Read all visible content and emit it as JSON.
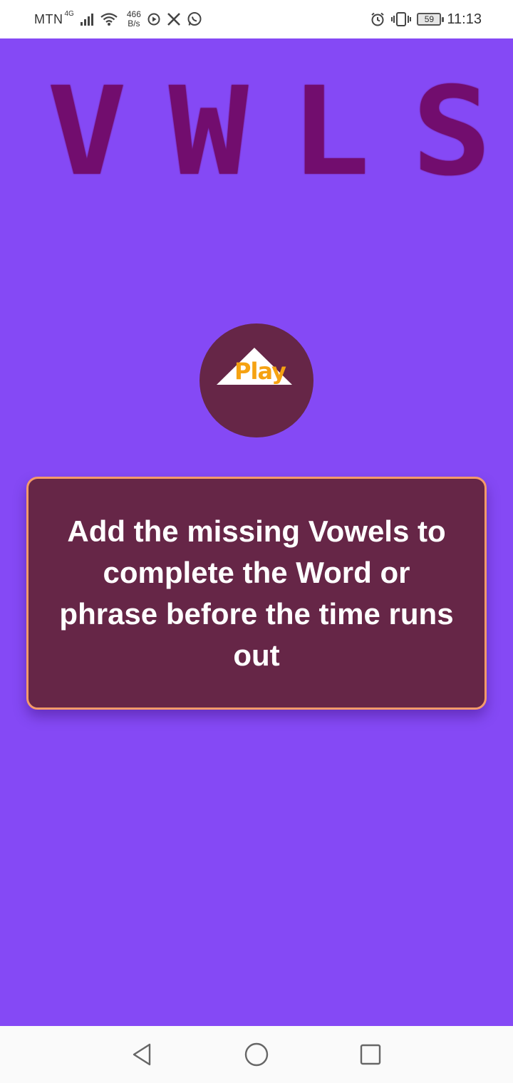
{
  "status_bar": {
    "carrier": "MTN",
    "network": "4G",
    "speed_value": "466",
    "speed_unit": "B/s",
    "battery": "59",
    "time": "11:13",
    "icons": [
      "signal-icon",
      "wifi-icon",
      "sync-icon",
      "x-app-icon",
      "whatsapp-icon",
      "alarm-icon",
      "vibrate-icon",
      "battery-icon"
    ]
  },
  "logo": {
    "letters": [
      "V",
      "W",
      "L",
      "S"
    ],
    "color": "#720d6e"
  },
  "play_button": {
    "label": "Play",
    "label_color": "#f5a212",
    "background": "#662647"
  },
  "instruction": {
    "text": "Add the missing Vowels to complete the Word or phrase before the time runs out"
  },
  "theme": {
    "background": "#8549f5",
    "card_background": "#662647",
    "card_border": "#f59a6a"
  },
  "nav_bar": {
    "icons": [
      "back-icon",
      "home-icon",
      "recent-apps-icon"
    ]
  }
}
